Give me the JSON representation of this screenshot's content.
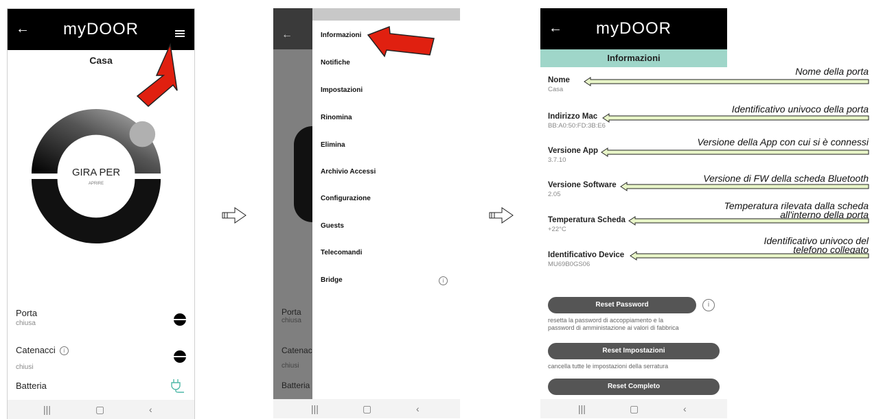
{
  "screen1": {
    "logo": "myDOOR",
    "subtitle": "Casa",
    "dial_main": "GIRA PER",
    "dial_sub": "APRIRE",
    "statuses": [
      {
        "label": "Porta",
        "value": "chiusa"
      },
      {
        "label": "Catenacci",
        "value": "chiusi"
      },
      {
        "label": "Batteria",
        "value": ""
      }
    ]
  },
  "screen2": {
    "menu": [
      "Informazioni",
      "Notifiche",
      "Impostazioni",
      "Rinomina",
      "Elimina",
      "Archivio Accessi",
      "Configurazione",
      "Guests",
      "Telecomandi",
      "Bridge"
    ],
    "behind": [
      {
        "label": "Porta",
        "value": "chiusa"
      },
      {
        "label": "Catenac",
        "value": "chiusi"
      },
      {
        "label": "Batteria",
        "value": ""
      }
    ]
  },
  "screen3": {
    "logo": "myDOOR",
    "title": "Informazioni",
    "fields": [
      {
        "key": "Nome",
        "value": "Casa"
      },
      {
        "key": "Indirizzo Mac",
        "value": "BB:A0:50:FD:3B:E6"
      },
      {
        "key": "Versione App",
        "value": "3.7.10"
      },
      {
        "key": "Versione Software",
        "value": "2.05"
      },
      {
        "key": "Temperatura Scheda",
        "value": "+22°C"
      },
      {
        "key": "Identificativo Device",
        "value": "MU69B0GS06"
      }
    ],
    "buttons": [
      "Reset Password",
      "Reset Impostazioni",
      "Reset Completo"
    ],
    "hints": [
      "resetta la password di accoppiamento e la",
      "password di amministazione ai valori di fabbrica",
      "cancella tutte le impostazioni della serratura"
    ]
  },
  "annotations": [
    "Nome della porta",
    "Identificativo univoco della porta",
    "Versione della App con cui si è connessi",
    "Versione di FW della scheda Bluetooth",
    "Temperatura rilevata dalla scheda",
    "all'interno della porta",
    "Identificativo univoco del",
    "telefono collegato"
  ],
  "colors": {
    "topbar": "#000000",
    "teal": "#9fd6c9",
    "button": "#555555",
    "arrow": "#e02010",
    "ring": "#111111"
  },
  "icons": [
    "back-arrow-icon",
    "hamburger-icon",
    "info-icon",
    "plug-icon",
    "recent-apps-icon",
    "home-icon",
    "nav-back-icon",
    "flow-arrow-icon"
  ]
}
